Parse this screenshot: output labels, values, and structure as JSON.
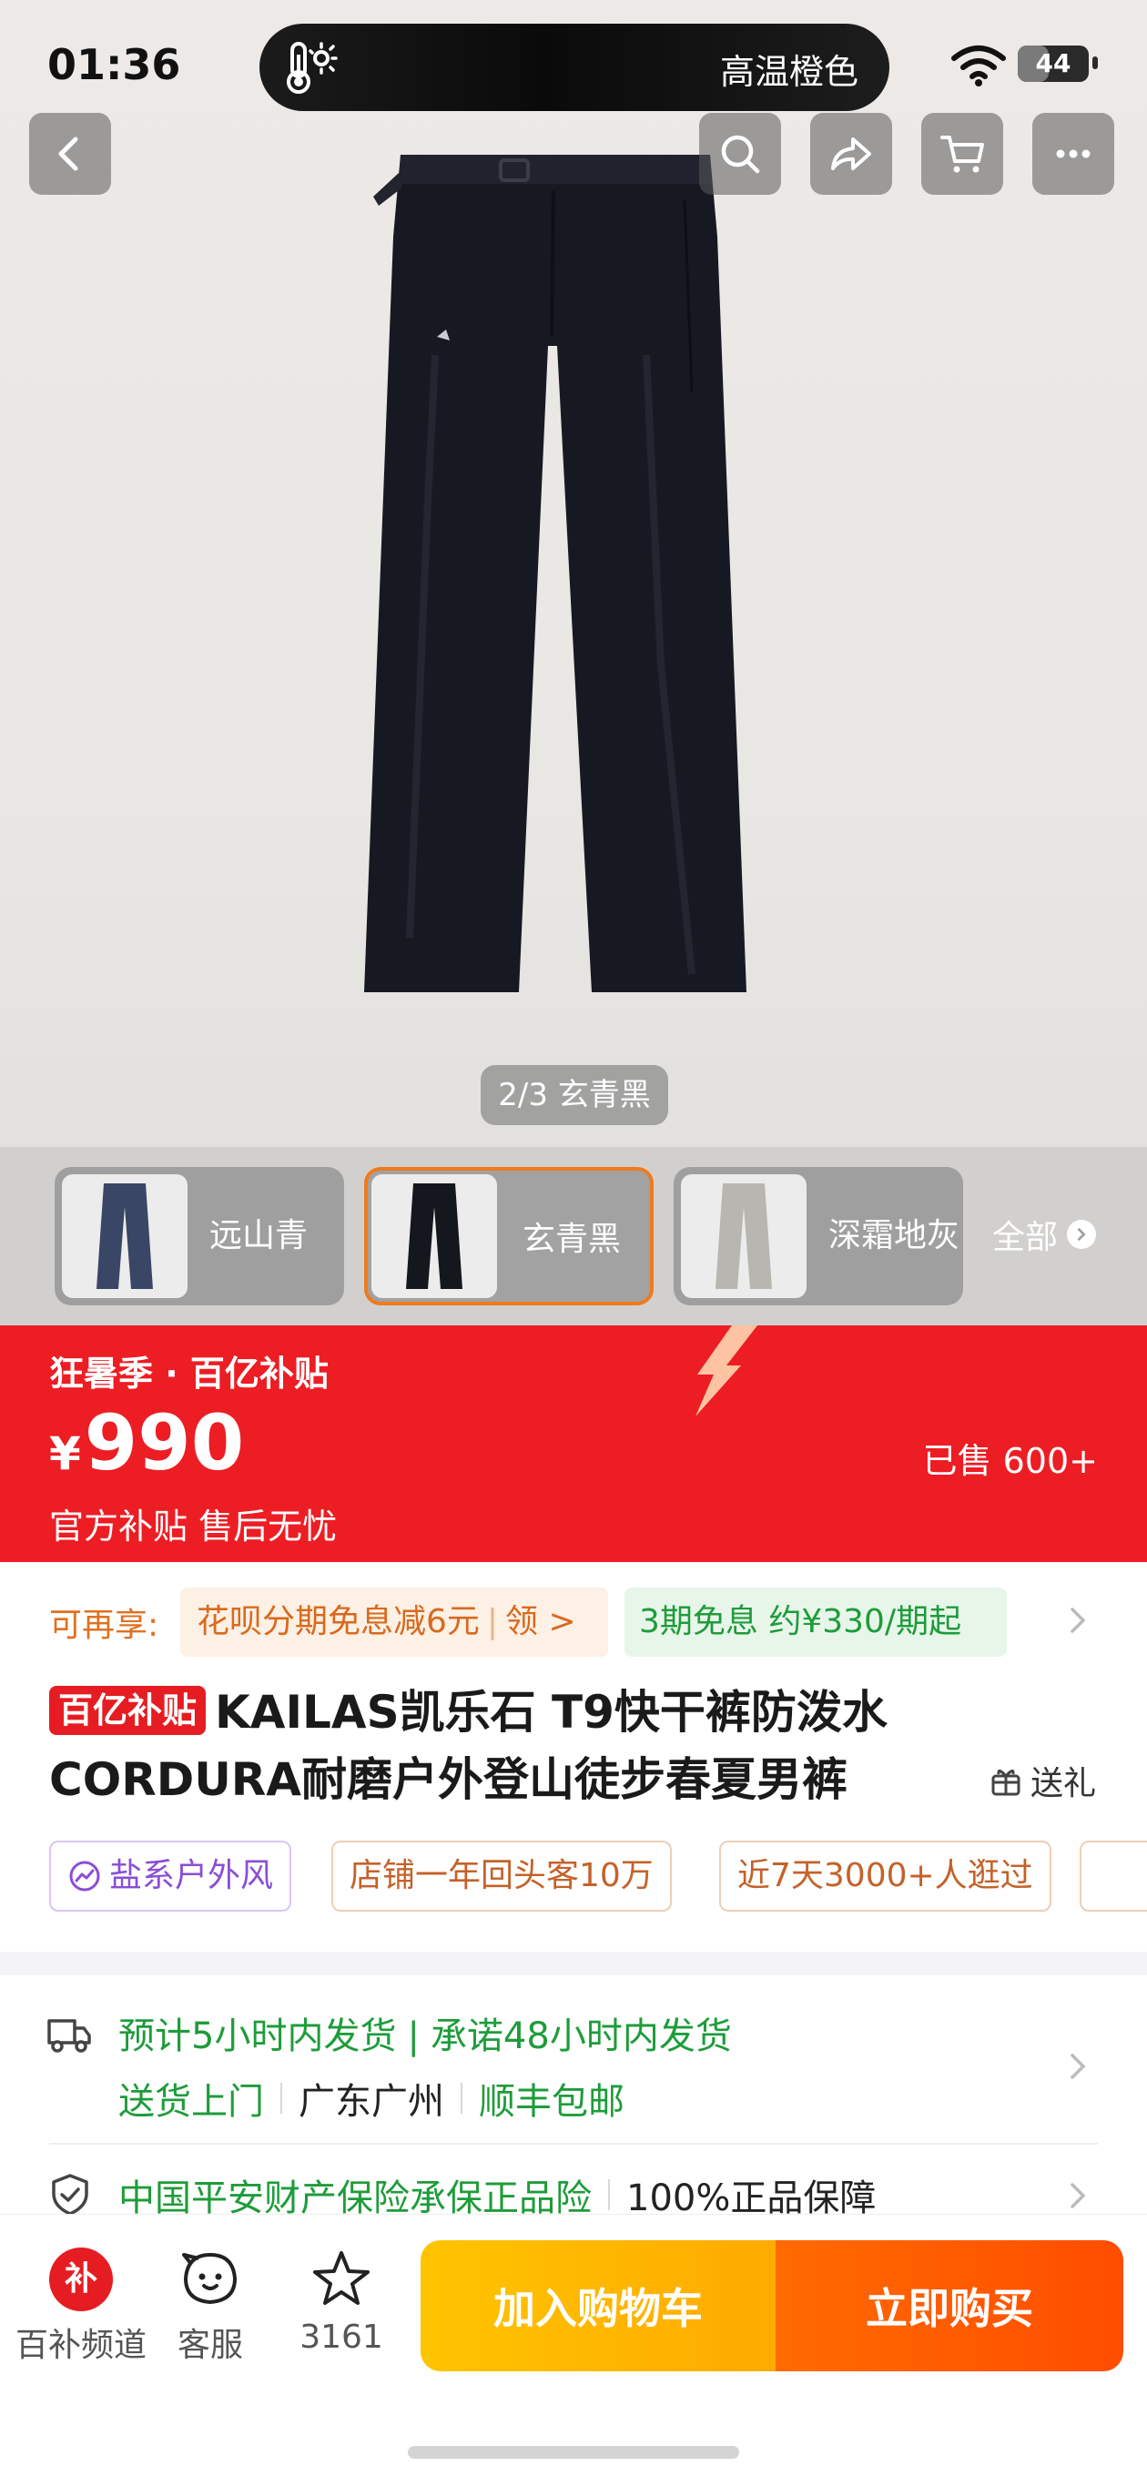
{
  "status_bar": {
    "time": "01:36",
    "island_text": "高温橙色",
    "battery": "44",
    "battery_level_percent": 44
  },
  "nav": {
    "back_icon": "chevron-left-icon",
    "search_icon": "search-icon",
    "share_icon": "share-icon",
    "cart_icon": "cart-icon",
    "more_icon": "more-icon"
  },
  "gallery": {
    "counter": "2/3 玄青黑"
  },
  "variants": {
    "items": [
      {
        "label": "远山青",
        "color": "#3a4666"
      },
      {
        "label": "玄青黑",
        "color": "#15171e"
      },
      {
        "label": "深霜地灰",
        "color": "#b8b6b0"
      }
    ],
    "selected_index": 1,
    "all_label": "全部"
  },
  "promo": {
    "title": "狂暑季 · 百亿补贴",
    "currency": "¥",
    "price": "990",
    "sold": "已售 600+",
    "subtitle": "官方补贴 售后无忧",
    "color": "#ed1d24"
  },
  "payment": {
    "label": "可再享:",
    "offer": "花呗分期免息减6元",
    "offer_action": "领 >",
    "installment": "3期免息 约¥330/期起"
  },
  "product": {
    "badge": "百亿补贴",
    "title": "KAILAS凯乐石 T9快干裤防泼水CORDURA耐磨户外登山徒步春夏男裤",
    "gift_label": "送礼"
  },
  "tags": [
    "盐系户外风",
    "店铺一年回头客10万",
    "近7天3000+人逛过"
  ],
  "shipping": {
    "estimate": "预计5小时内发货",
    "promise": "承诺48小时内发货",
    "delivery": "送货上门",
    "location": "广东广州",
    "carrier": "顺丰包邮"
  },
  "insurance": {
    "text": "中国平安财产保险承保正品险",
    "guarantee": "100%正品保障"
  },
  "bottom_bar": {
    "subsidy_badge": "补",
    "subsidy_label": "百补频道",
    "service_label": "客服",
    "favorites_count": "3161",
    "add_to_cart": "加入购物车",
    "buy_now": "立即购买"
  }
}
